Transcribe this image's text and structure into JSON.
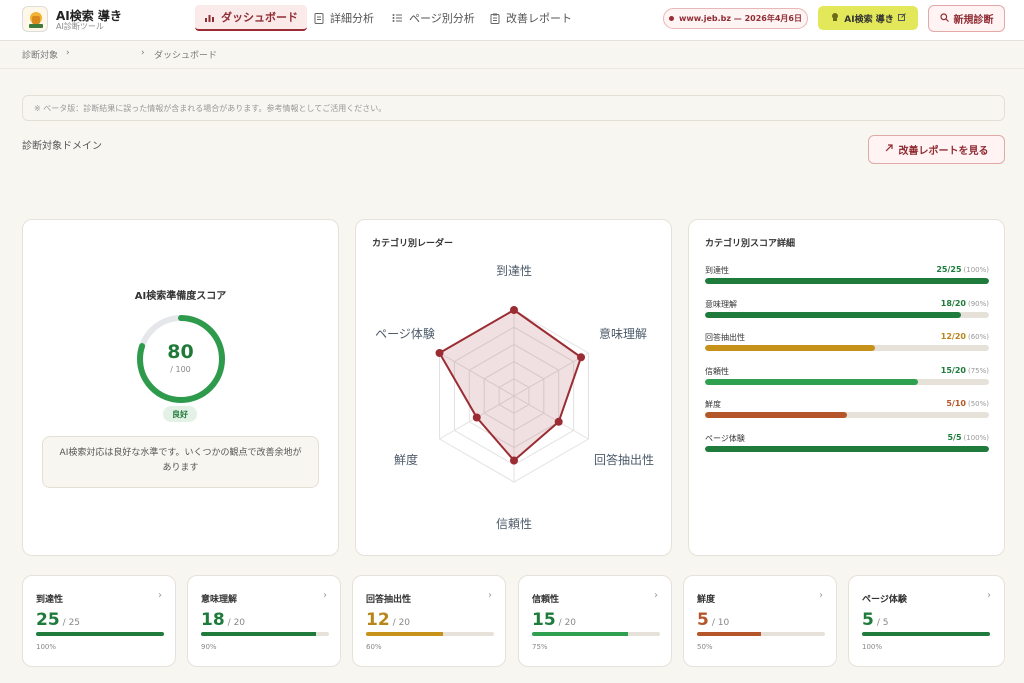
{
  "header": {
    "brand_name": "AI検索 導き",
    "brand_sub": "AI診断ツール",
    "nav": [
      {
        "label": "ダッシュボード",
        "icon": "bar-chart-icon",
        "active": true
      },
      {
        "label": "詳細分析",
        "icon": "document-icon",
        "active": false
      },
      {
        "label": "ページ別分析",
        "icon": "list-icon",
        "active": false
      },
      {
        "label": "改善レポート",
        "icon": "clipboard-icon",
        "active": false
      }
    ],
    "domain_pill": "www.jeb.bz — 2026年4月6日",
    "ai_button": "AI検索 導き",
    "new_button": "新規診断"
  },
  "breadcrumb": {
    "root": "診断対象",
    "current": "ダッシュボード"
  },
  "notice": "※ ベータ版：診断結果に誤った情報が含まれる場合があります。参考情報としてご活用ください。",
  "domain_label": "診断対象ドメイン",
  "report_button": "改善レポートを見る",
  "score_card": {
    "title": "AI検索準備度スコア",
    "score": "80",
    "max": "/ 100",
    "score_fraction": 0.8,
    "badge": "良好",
    "message": "AI検索対応は良好な水準です。いくつかの観点で改善余地があります"
  },
  "radar_card": {
    "title": "カテゴリ別レーダー"
  },
  "detail_card": {
    "title": "カテゴリ別スコア詳細"
  },
  "categories": [
    {
      "name": "到達性",
      "value": 25,
      "max": 25,
      "score": "25/25",
      "pct": "(100%)",
      "pct_plain": "100%",
      "color": "#1e7b3b",
      "value_color": "#1e7b3b"
    },
    {
      "name": "意味理解",
      "value": 18,
      "max": 20,
      "score": "18/20",
      "pct": "(90%)",
      "pct_plain": "90%",
      "color": "#1e7b3b",
      "value_color": "#1e7b3b"
    },
    {
      "name": "回答抽出性",
      "value": 12,
      "max": 20,
      "score": "12/20",
      "pct": "(60%)",
      "pct_plain": "60%",
      "color": "#c6921a",
      "value_color": "#b7861a"
    },
    {
      "name": "信頼性",
      "value": 15,
      "max": 20,
      "score": "15/20",
      "pct": "(75%)",
      "pct_plain": "75%",
      "color": "#2fa04f",
      "value_color": "#1e7b3b"
    },
    {
      "name": "鮮度",
      "value": 5,
      "max": 10,
      "score": "5/10",
      "pct": "(50%)",
      "pct_plain": "50%",
      "color": "#b5562a",
      "value_color": "#b5562a"
    },
    {
      "name": "ページ体験",
      "value": 5,
      "max": 5,
      "score": "5/5",
      "pct": "(100%)",
      "pct_plain": "100%",
      "color": "#1e7b3b",
      "value_color": "#1e7b3b"
    }
  ],
  "mini_cards": [
    {
      "name": "到達性",
      "value": "25",
      "max": "/ 25",
      "pct": "100%"
    },
    {
      "name": "意味理解",
      "value": "18",
      "max": "/ 20",
      "pct": "90%"
    },
    {
      "name": "回答抽出性",
      "value": "12",
      "max": "/ 20",
      "pct": "60%"
    },
    {
      "name": "信頼性",
      "value": "15",
      "max": "/ 20",
      "pct": "75%"
    },
    {
      "name": "鮮度",
      "value": "5",
      "max": "/ 10",
      "pct": "50%"
    },
    {
      "name": "ページ体験",
      "value": "5",
      "max": "/ 5",
      "pct": "100%"
    }
  ],
  "colors": {
    "accent": "#9b2c33",
    "good": "#1e7b3b",
    "warn": "#c6921a",
    "bad": "#b5562a"
  }
}
